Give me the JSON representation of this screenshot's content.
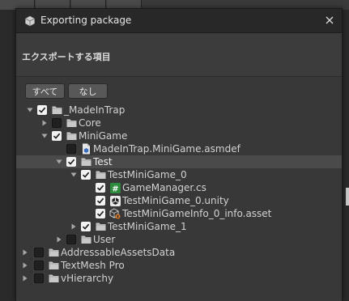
{
  "window": {
    "title": "Exporting package",
    "section_title": "エクスポートする項目"
  },
  "buttons": {
    "select_all": "すべて",
    "select_none": "なし"
  },
  "tree": [
    {
      "label": "_MadeInTrap",
      "depth": 0,
      "expanded": true,
      "checked": true,
      "icon": "folder-icon"
    },
    {
      "label": "Core",
      "depth": 1,
      "expanded": false,
      "checked": false,
      "icon": "folder-icon"
    },
    {
      "label": "MiniGame",
      "depth": 1,
      "expanded": true,
      "checked": true,
      "icon": "folder-icon"
    },
    {
      "label": "MadeInTrap.MiniGame.asmdef",
      "depth": 2,
      "leaf": true,
      "checked": false,
      "icon": "asmdef-icon"
    },
    {
      "label": "Test",
      "depth": 2,
      "expanded": true,
      "checked": true,
      "icon": "folder-icon",
      "selected": true
    },
    {
      "label": "TestMiniGame_0",
      "depth": 3,
      "expanded": true,
      "checked": true,
      "icon": "folder-icon"
    },
    {
      "label": "GameManager.cs",
      "depth": 4,
      "leaf": true,
      "checked": true,
      "icon": "csharp-script-icon"
    },
    {
      "label": "TestMiniGame_0.unity",
      "depth": 4,
      "leaf": true,
      "checked": true,
      "icon": "unity-scene-icon"
    },
    {
      "label": "TestMiniGameInfo_0_info.asset",
      "depth": 4,
      "leaf": true,
      "checked": true,
      "icon": "scriptable-asset-icon"
    },
    {
      "label": "TestMiniGame_1",
      "depth": 3,
      "expanded": false,
      "checked": true,
      "icon": "folder-icon"
    },
    {
      "label": "User",
      "depth": 2,
      "expanded": false,
      "checked": false,
      "icon": "folder-icon"
    },
    {
      "label": "AddressableAssetsData",
      "depth": -1,
      "expanded": false,
      "checked": false,
      "icon": "folder-icon"
    },
    {
      "label": "TextMesh Pro",
      "depth": -1,
      "expanded": false,
      "checked": false,
      "icon": "folder-icon"
    },
    {
      "label": "vHierarchy",
      "depth": -1,
      "expanded": false,
      "checked": false,
      "icon": "folder-icon"
    }
  ],
  "colors": {
    "window_bg": "#383838",
    "titlebar_bg": "#282828",
    "selected_row": "#4a4a4a",
    "checkbox_on": "#f2f2f2",
    "folder": "#c8c8c8",
    "csharp": "#3a9b3a",
    "scene_icon_bg": "#e8e8e8",
    "asset_accent": "#d87a2a"
  }
}
